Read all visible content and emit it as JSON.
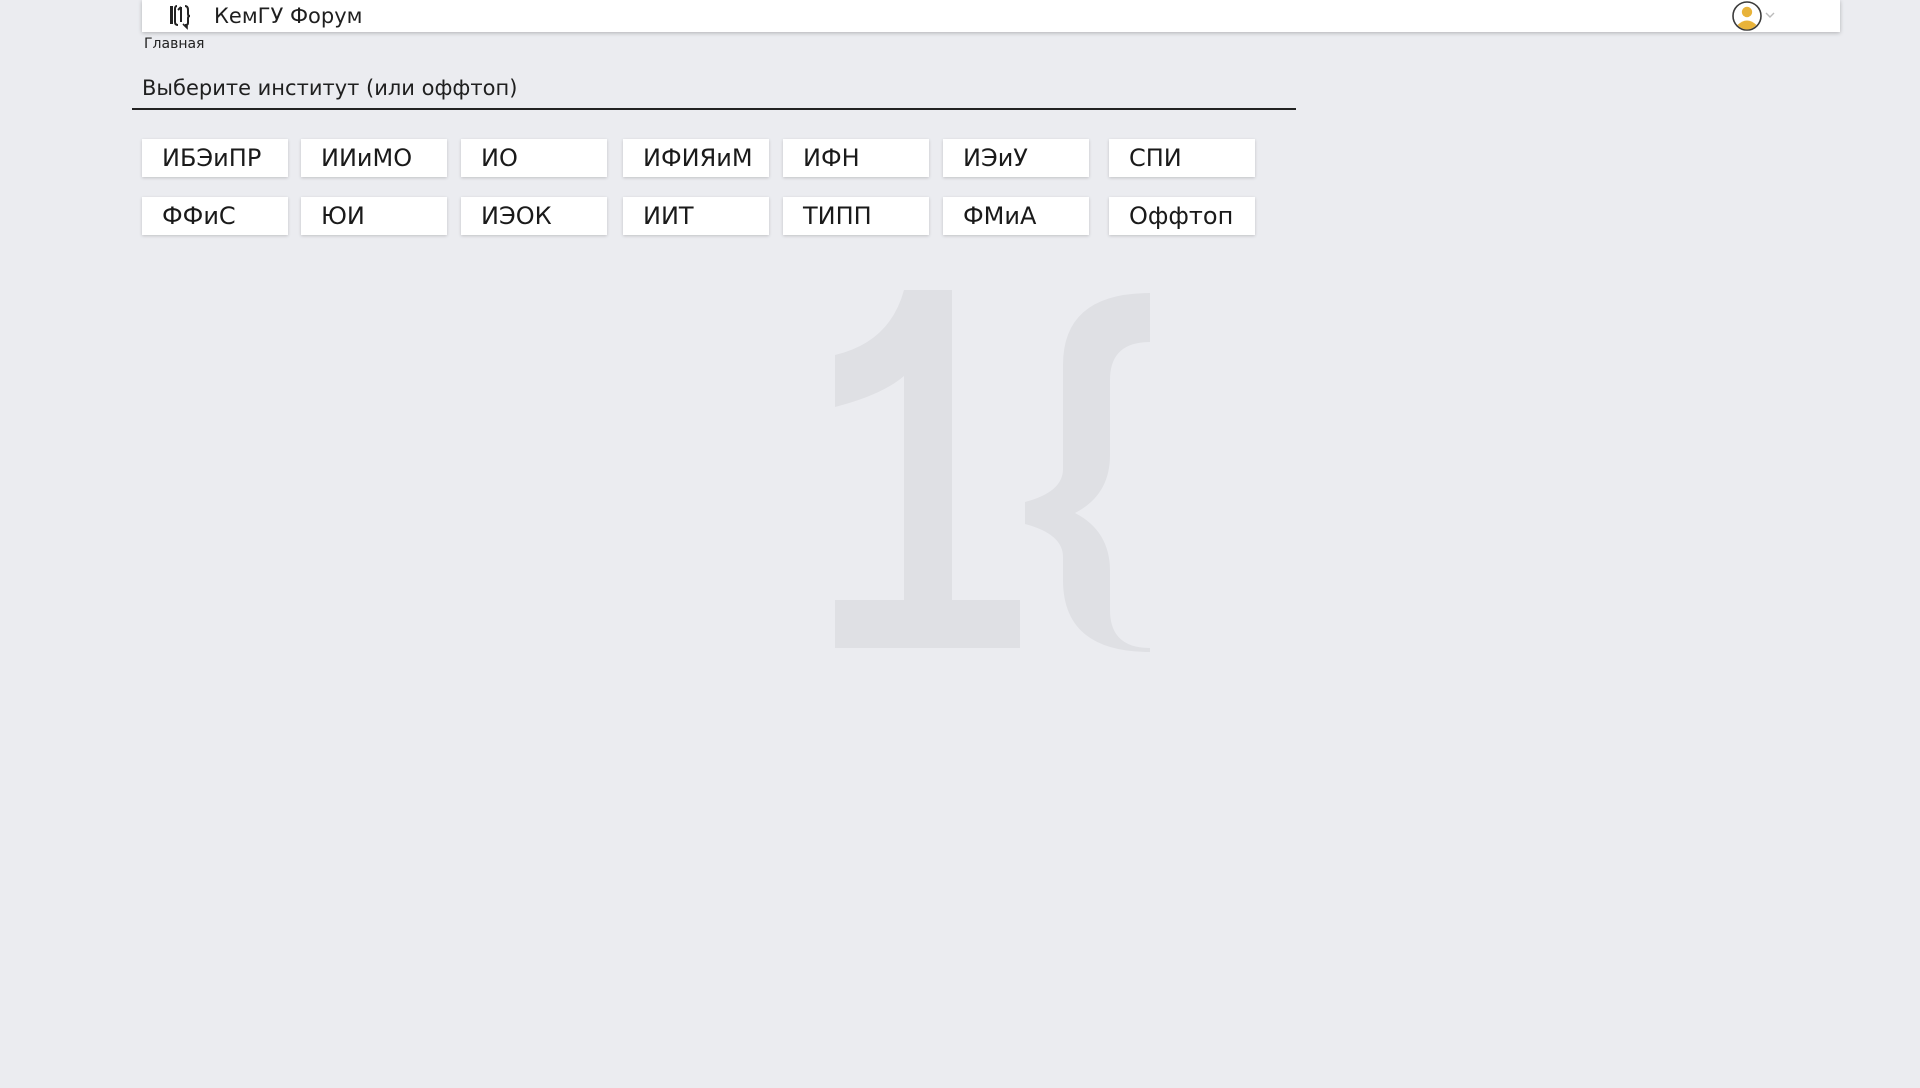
{
  "header": {
    "app_title": "КемГУ Форум",
    "logo_icon": "kemsu-logo-icon",
    "avatar_icon": "user-avatar-icon",
    "caret_icon": "chevron-down-icon"
  },
  "breadcrumb": {
    "home": "Главная"
  },
  "main": {
    "section_title": "Выберите институт (или оффтоп)",
    "institutes": [
      {
        "label": "ИБЭиПР"
      },
      {
        "label": "ИИиМО"
      },
      {
        "label": "ИО"
      },
      {
        "label": "ИФИЯиМ"
      },
      {
        "label": "ИФН"
      },
      {
        "label": "ИЭиУ"
      },
      {
        "label": "СПИ"
      },
      {
        "label": "ФФиС"
      },
      {
        "label": "ЮИ"
      },
      {
        "label": "ИЭОК"
      },
      {
        "label": "ИИТ"
      },
      {
        "label": "ТИПП"
      },
      {
        "label": "ФМиА"
      },
      {
        "label": "Оффтоп"
      }
    ]
  },
  "colors": {
    "background": "#ebecf0",
    "surface": "#ffffff",
    "watermark": "#dfe0e4",
    "avatar_accent": "#e8b33a"
  },
  "watermark_icon": "kemsu-watermark-logo"
}
